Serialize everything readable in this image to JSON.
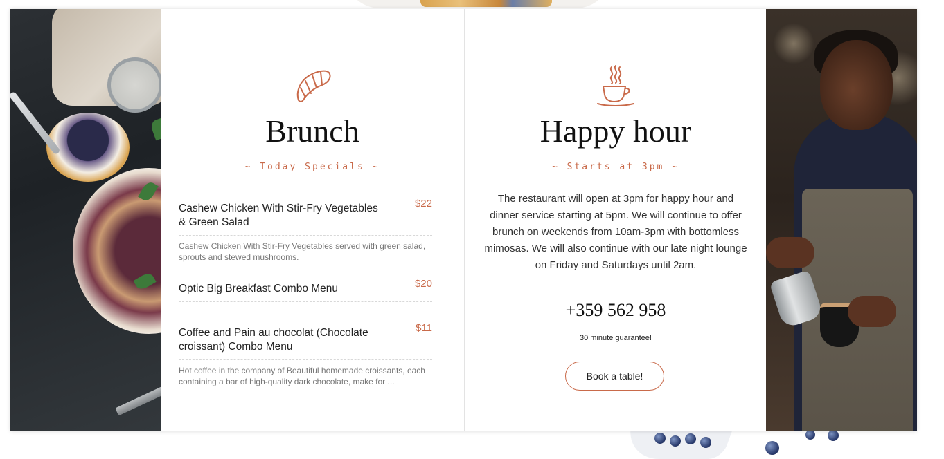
{
  "brand_color": "#c96a4a",
  "brunch": {
    "icon": "croissant-icon",
    "title": "Brunch",
    "subtitle": "~ Today Specials ~",
    "items": [
      {
        "name": "Cashew Chicken With Stir-Fry Vegetables & Green Salad",
        "price": "$22",
        "description": "Cashew Chicken With Stir-Fry Vegetables served with green salad, sprouts and stewed mushrooms."
      },
      {
        "name": "Optic Big Breakfast Combo Menu",
        "price": "$20",
        "description": ""
      },
      {
        "name": "Coffee and Pain au chocolat (Chocolate croissant) Combo Menu",
        "price": "$11",
        "description": "Hot coffee in the company of Beautiful homemade croissants, each containing a bar of high-quality dark chocolate, make for ..."
      }
    ]
  },
  "happy_hour": {
    "icon": "coffee-cup-icon",
    "title": "Happy hour",
    "subtitle": "~ Starts at 3pm ~",
    "text": "The restaurant will open at 3pm for happy hour and dinner service starting at 5pm. We will continue to offer brunch on weekends from 10am-3pm with bottomless mimosas. We will also continue with our late night lounge on Friday and Saturdays until 2am.",
    "phone": "+359 562 958",
    "guarantee": "30 minute guarantee!",
    "book_label": "Book a table!"
  }
}
